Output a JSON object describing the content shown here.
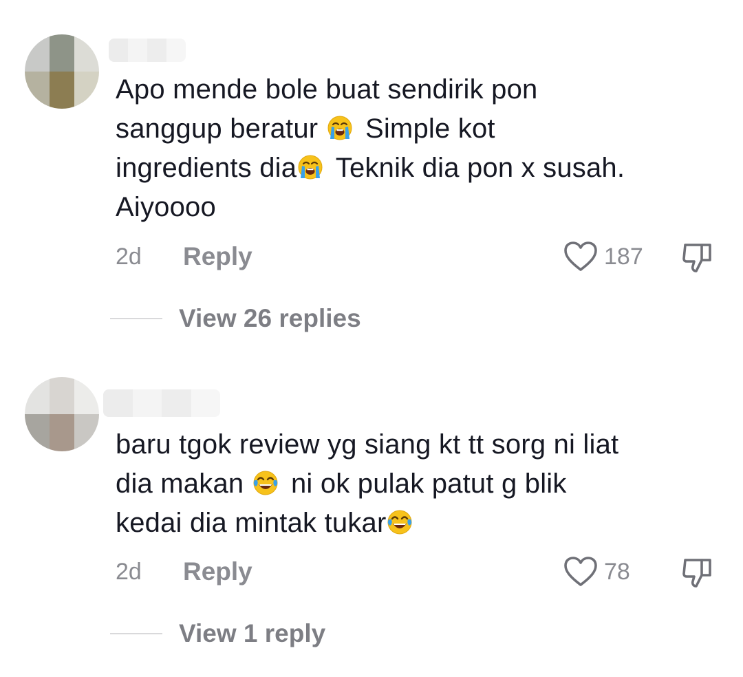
{
  "comments": [
    {
      "username": "",
      "text_lines": [
        {
          "before": "Apo mende bole buat sendirik pon",
          "emoji": null,
          "after": ""
        },
        {
          "before": "sanggup beratur ",
          "emoji": "loudly-crying-face",
          "after": " Simple kot"
        },
        {
          "before": "ingredients dia",
          "emoji": "loudly-crying-face",
          "after": " Teknik dia pon x susah."
        },
        {
          "before": "Aiyoooo",
          "emoji": null,
          "after": ""
        }
      ],
      "time": "2d",
      "reply_label": "Reply",
      "likes": "187",
      "view_replies": "View 26 replies"
    },
    {
      "username": "",
      "text_lines": [
        {
          "before": "baru tgok review yg siang kt tt sorg ni liat",
          "emoji": null,
          "after": ""
        },
        {
          "before": "dia makan ",
          "emoji": "face-with-tears-of-joy",
          "after": " ni ok pulak patut g blik"
        },
        {
          "before": "kedai dia mintak tukar",
          "emoji": "face-with-tears-of-joy",
          "after": ""
        }
      ],
      "time": "2d",
      "reply_label": "Reply",
      "likes": "78",
      "view_replies": "View 1 reply"
    }
  ],
  "colors": {
    "text": "#161823",
    "muted": "#8a8b91",
    "view_replies": "#7d7e84"
  },
  "icons": {
    "like": "heart-outline-icon",
    "dislike": "thumbs-down-outline-icon"
  }
}
